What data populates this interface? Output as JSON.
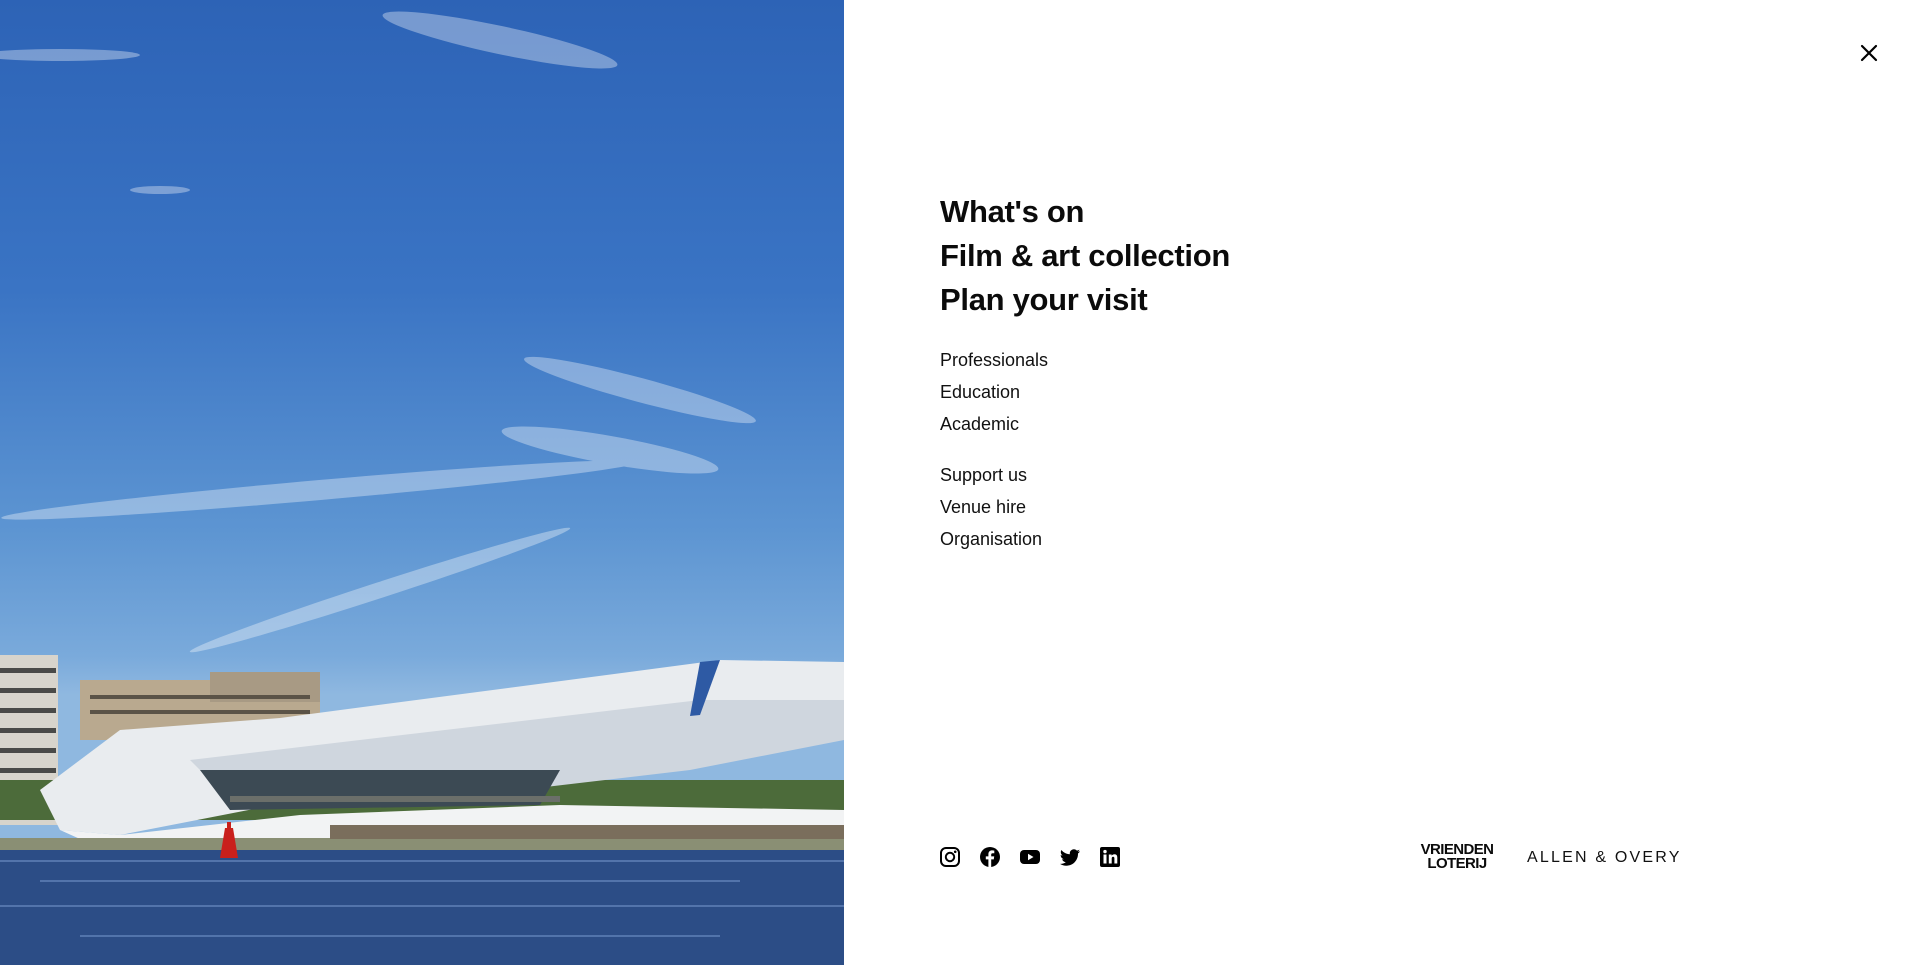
{
  "hero_image": {
    "subject": "eye-film-museum-building"
  },
  "close_icon": "close-icon",
  "menu": {
    "primary": [
      {
        "label": "What's on"
      },
      {
        "label": "Film & art collection"
      },
      {
        "label": "Plan your visit"
      }
    ],
    "secondary_group_1": [
      {
        "label": "Professionals"
      },
      {
        "label": "Education"
      },
      {
        "label": "Academic"
      }
    ],
    "secondary_group_2": [
      {
        "label": "Support us"
      },
      {
        "label": "Venue hire"
      },
      {
        "label": "Organisation"
      }
    ]
  },
  "socials": [
    "instagram-icon",
    "facebook-icon",
    "youtube-icon",
    "twitter-icon",
    "linkedin-icon"
  ],
  "sponsors": {
    "vriendenloterij_line1": "VRIENDEN",
    "vriendenloterij_line2": "LOTERIJ",
    "allen_overy": "ALLEN & OVERY"
  }
}
